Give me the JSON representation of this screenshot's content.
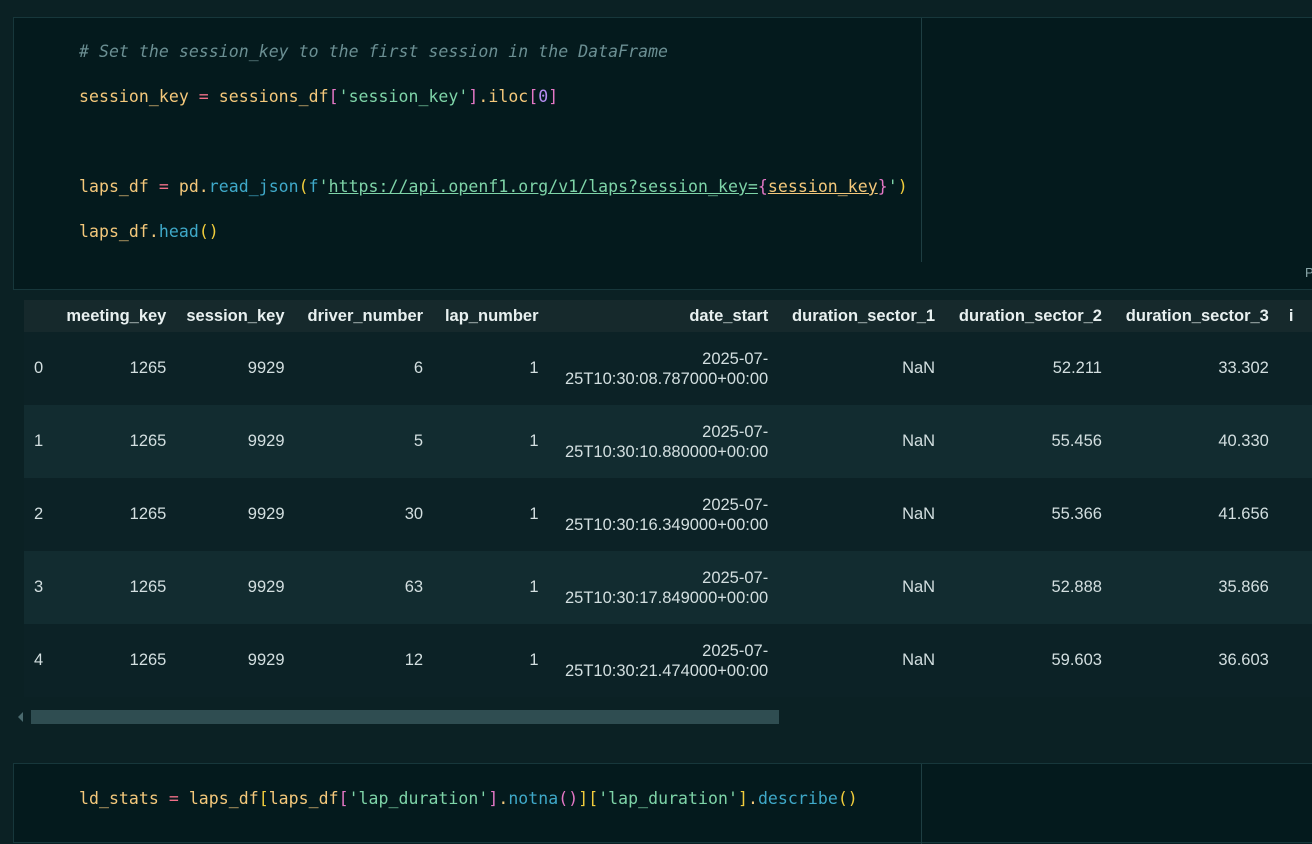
{
  "cell1": {
    "comment": "# Set the session_key to the first session in the DataFrame",
    "line2": {
      "var": "session_key",
      "eq": " = ",
      "obj": "sessions_df",
      "ob": "[",
      "key": "'session_key'",
      "cb": "]",
      "method": ".iloc",
      "ob2": "[",
      "num": "0",
      "cb2": "]"
    },
    "line3": {
      "var": "laps_df",
      "eq": " = ",
      "obj": "pd.",
      "fn": "read_json",
      "op": "(",
      "prefix": "f",
      "q1": "'",
      "url": "https://api.openf1.org/v1/laps?session_key=",
      "lb": "{",
      "inner": "session_key",
      "rb": "}",
      "q2": "'",
      "cp": ")"
    },
    "line4": {
      "var": "laps_df.",
      "fn": "head",
      "parens": "()"
    }
  },
  "corner_label": "P",
  "table": {
    "columns": [
      "",
      "meeting_key",
      "session_key",
      "driver_number",
      "lap_number",
      "date_start",
      "duration_sector_1",
      "duration_sector_2",
      "duration_sector_3",
      "i"
    ],
    "rows": [
      [
        "0",
        "1265",
        "9929",
        "6",
        "1",
        "2025-07-",
        "25T10:30:08.787000+00:00",
        "NaN",
        "52.211",
        "33.302"
      ],
      [
        "1",
        "1265",
        "9929",
        "5",
        "1",
        "2025-07-",
        "25T10:30:10.880000+00:00",
        "NaN",
        "55.456",
        "40.330"
      ],
      [
        "2",
        "1265",
        "9929",
        "30",
        "1",
        "2025-07-",
        "25T10:30:16.349000+00:00",
        "NaN",
        "55.366",
        "41.656"
      ],
      [
        "3",
        "1265",
        "9929",
        "63",
        "1",
        "2025-07-",
        "25T10:30:17.849000+00:00",
        "NaN",
        "52.888",
        "35.866"
      ],
      [
        "4",
        "1265",
        "9929",
        "12",
        "1",
        "2025-07-",
        "25T10:30:21.474000+00:00",
        "NaN",
        "59.603",
        "36.603"
      ]
    ]
  },
  "cell2": {
    "var": "ld_stats",
    "eq": " = ",
    "a": "laps_df",
    "b1": "[",
    "c": "laps_df",
    "b2": "[",
    "k1": "'lap_duration'",
    "b3": "]",
    "m1": ".",
    "f1": "notna",
    "p1": "()",
    "b4": "]",
    "b5": "[",
    "k2": "'lap_duration'",
    "b6": "]",
    "m2": ".",
    "f2": "describe",
    "p2": "()"
  }
}
